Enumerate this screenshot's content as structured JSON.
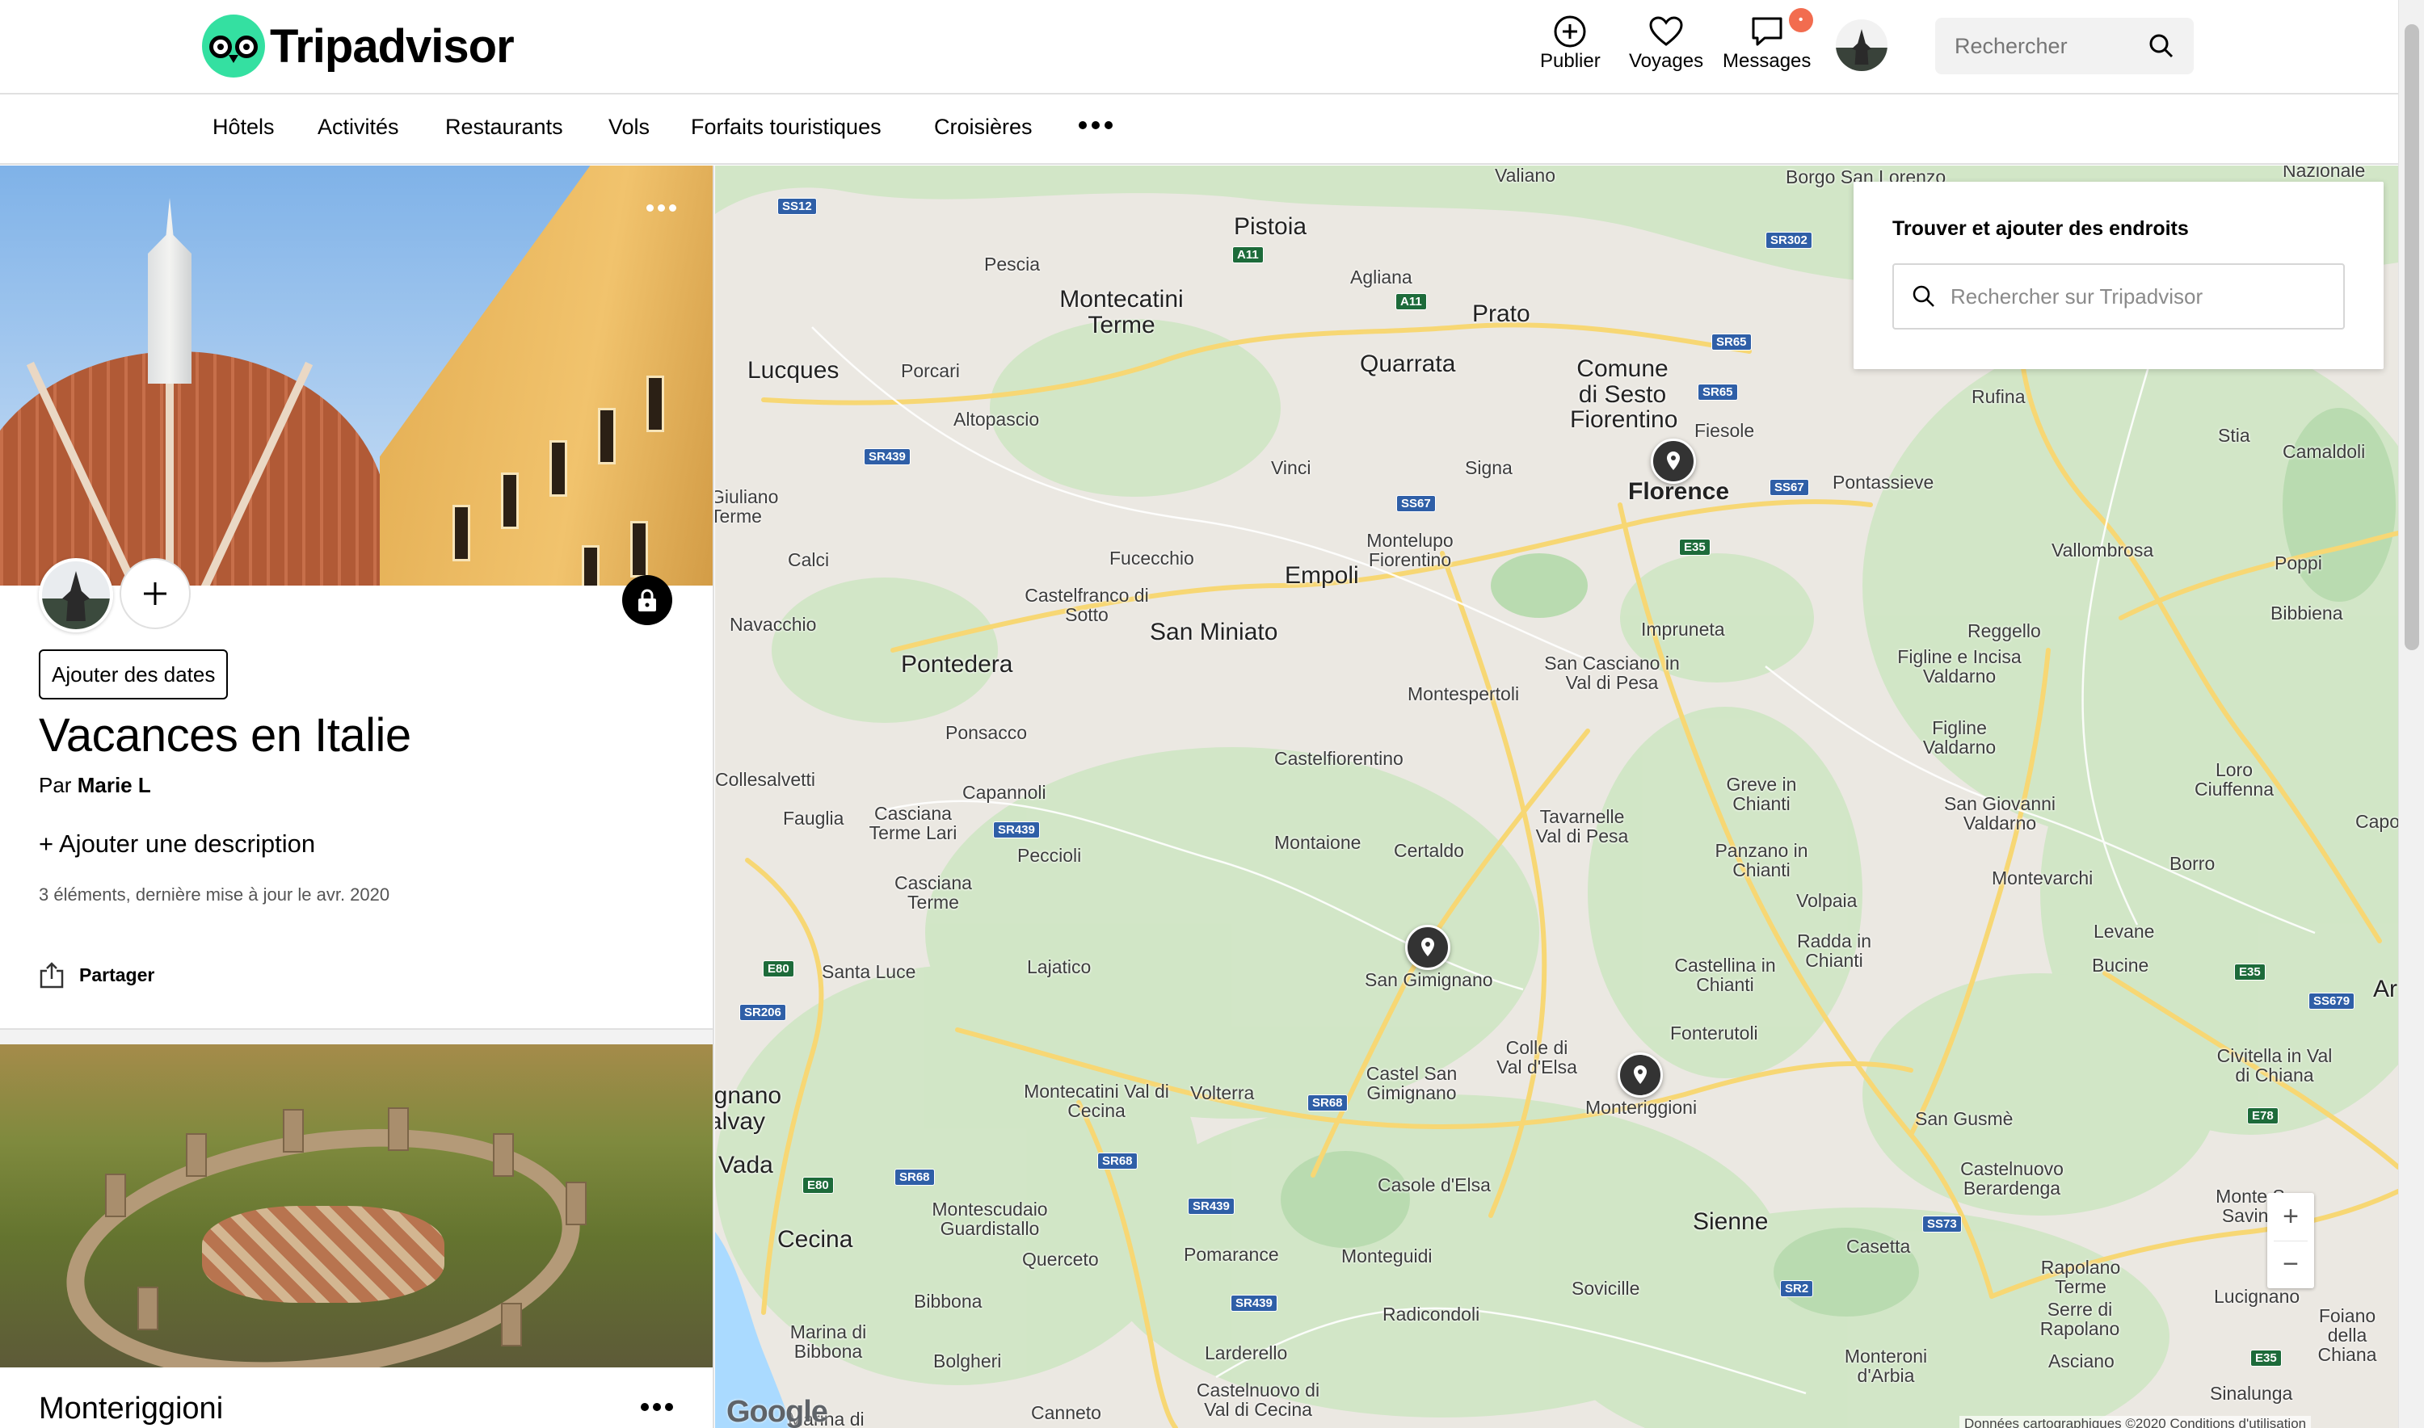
{
  "header": {
    "brand": "Tripadvisor",
    "nav": [
      {
        "label": "Publier",
        "icon": "plus-circle-icon"
      },
      {
        "label": "Voyages",
        "icon": "heart-icon"
      },
      {
        "label": "Messages",
        "icon": "chat-icon",
        "badge": "•"
      }
    ],
    "search_placeholder": "Rechercher"
  },
  "subnav": {
    "items": [
      "Hôtels",
      "Activités",
      "Restaurants",
      "Vols",
      "Forfaits touristiques",
      "Croisières"
    ],
    "more_icon": "more-dots-icon"
  },
  "trip": {
    "add_dates_label": "Ajouter des dates",
    "title": "Vacances en Italie",
    "by_prefix": "Par",
    "author": "Marie L",
    "add_description": "+ Ajouter une description",
    "meta": "3 éléments, dernière mise à jour le avr. 2020",
    "share_label": "Partager"
  },
  "first_item": {
    "title": "Monteriggioni"
  },
  "map": {
    "find_title": "Trouver et ajouter des endroits",
    "find_placeholder": "Rechercher sur Tripadvisor",
    "zoom_in": "+",
    "zoom_out": "−",
    "google_logo": "Google",
    "attribution": "Données cartographiques ©2020   Conditions d'utilisation",
    "pins": [
      "Florence",
      "San Gimignano",
      "Monteriggioni"
    ],
    "places": {
      "valiano": "Valiano",
      "borgo": "Borgo San Lorenzo",
      "nazionale": "Nazionale",
      "pistoia": "Pistoia",
      "pescia": "Pescia",
      "montecatini": "Montecatini Terme",
      "agliana": "Agliana",
      "prato": "Prato",
      "lucques": "Lucques",
      "porcari": "Porcari",
      "altopascio": "Altopascio",
      "quarrata": "Quarrata",
      "sesto": "Comune di Sesto Fiorentino",
      "fiesole": "Fiesole",
      "rufina": "Rufina",
      "stia": "Stia",
      "camaldoli": "Camaldoli",
      "giuliano": "Giuliano Terme",
      "vinci": "Vinci",
      "signa": "Signa",
      "florence": "Florence",
      "pontassieve": "Pontassieve",
      "calci": "Calci",
      "fucecchio": "Fucecchio",
      "montelupo": "Montelupo Fiorentino",
      "vallombrosa": "Vallombrosa",
      "poppi": "Poppi",
      "empoli": "Empoli",
      "castelfranco": "Castelfranco di Sotto",
      "sanminiato": "San Miniato",
      "navacchio": "Navacchio",
      "impruneta": "Impruneta",
      "reggello": "Reggello",
      "bibbiena": "Bibbiena",
      "pontedera": "Pontedera",
      "sancasciano": "San Casciano in Val di Pesa",
      "figline": "Figline e Incisa Valdarno",
      "montespertoli": "Montespertoli",
      "ponsacco": "Ponsacco",
      "figline2": "Figline Valdarno",
      "castelfiorentino": "Castelfiorentino",
      "collesalvetti": "Collesalvetti",
      "capannoli": "Capannoli",
      "loro": "Loro Ciuffenna",
      "greve": "Greve in Chianti",
      "fauglia": "Fauglia",
      "casciana": "Casciana Terme Lari",
      "tavarnelle": "Tavarnelle Val di Pesa",
      "sangiovanni": "San Giovanni Valdarno",
      "capo": "Capo",
      "peccioli": "Peccioli",
      "montaione": "Montaione",
      "certaldo": "Certaldo",
      "panzano": "Panzano in Chianti",
      "borro": "Borro",
      "cascianaterme": "Casciana Terme",
      "montevarchi": "Montevarchi",
      "volpaia": "Volpaia",
      "levane": "Levane",
      "santaluce": "Santa Luce",
      "lajatico": "Lajatico",
      "sangimignano": "San Gimignano",
      "radda": "Radda in Chianti",
      "bucine": "Bucine",
      "castellina": "Castellina in Chianti",
      "fonterutoli": "Fonterutoli",
      "colle": "Colle di Val d'Elsa",
      "civitella": "Civitella in Val di Chiana",
      "ignano": "ignano alvay",
      "montecatinicecina": "Montecatini Val di Cecina",
      "volterra": "Volterra",
      "castelsan": "Castel San Gimignano",
      "monteriggioni": "Monteriggioni",
      "sangusme": "San Gusmè",
      "vada": "Vada",
      "castelnuovo": "Castelnuovo Berardenga",
      "casole": "Casole d'Elsa",
      "montescudaio": "Montescudaio Guardistallo",
      "cecina": "Cecina",
      "querceto": "Querceto",
      "pomarance": "Pomarance",
      "monteguidi": "Monteguidi",
      "sienne": "Sienne",
      "casetta": "Casetta",
      "rapolano": "Rapolano Terme",
      "serre": "Serre di Rapolano",
      "montesavino": "Monte S Savino",
      "lucignano": "Lucignano",
      "sovicille": "Sovicille",
      "bibbona": "Bibbona",
      "radicondoli": "Radicondoli",
      "foiano": "Foiano della Chiana",
      "marina": "Marina di Bibbona",
      "larderello": "Larderello",
      "monteroni": "Monteroni d'Arbia",
      "asciano": "Asciano",
      "bolgheri": "Bolgheri",
      "sinalunga": "Sinalunga",
      "castelnuovocecina": "Castelnuovo di Val di Cecina",
      "canneto": "Canneto",
      "marinadi": "Marina di",
      "ar": "Ar"
    },
    "roads": [
      "SS12",
      "A11",
      "SR302",
      "A11",
      "SR65",
      "SR65",
      "SR439",
      "SS67",
      "SS67",
      "E35",
      "SR439",
      "E80",
      "SR206",
      "SR68",
      "E35",
      "SS679",
      "E80",
      "SR68",
      "SR68",
      "SR439",
      "E78",
      "SS73",
      "SR439",
      "SR2",
      "E35"
    ]
  },
  "colors": {
    "brand": "#34e0a1",
    "badge": "#f26c4f",
    "map_road": "#f7d774",
    "map_green": "#cde6c2",
    "water": "#aadaff"
  }
}
